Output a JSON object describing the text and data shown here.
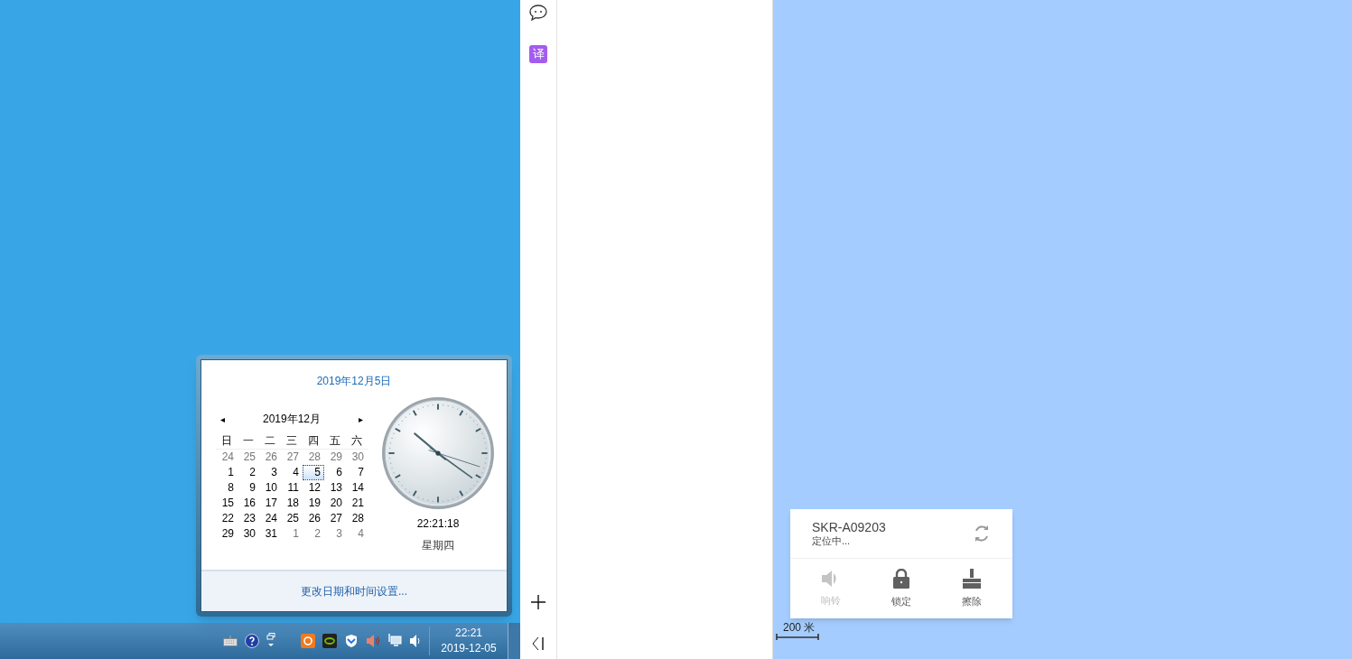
{
  "calendar_popup": {
    "title": "2019年12月5日",
    "month": "2019年12月",
    "prev": "◂",
    "next": "▸",
    "weekdays": [
      "日",
      "一",
      "二",
      "三",
      "四",
      "五",
      "六"
    ],
    "weeks": [
      [
        {
          "day": "24",
          "other_month": true,
          "selected": false
        },
        {
          "day": "25",
          "other_month": true,
          "selected": false
        },
        {
          "day": "26",
          "other_month": true,
          "selected": false
        },
        {
          "day": "27",
          "other_month": true,
          "selected": false
        },
        {
          "day": "28",
          "other_month": true,
          "selected": false
        },
        {
          "day": "29",
          "other_month": true,
          "selected": false
        },
        {
          "day": "30",
          "other_month": true,
          "selected": false
        }
      ],
      [
        {
          "day": "1",
          "other_month": false,
          "selected": false
        },
        {
          "day": "2",
          "other_month": false,
          "selected": false
        },
        {
          "day": "3",
          "other_month": false,
          "selected": false
        },
        {
          "day": "4",
          "other_month": false,
          "selected": false
        },
        {
          "day": "5",
          "other_month": false,
          "selected": true
        },
        {
          "day": "6",
          "other_month": false,
          "selected": false
        },
        {
          "day": "7",
          "other_month": false,
          "selected": false
        }
      ],
      [
        {
          "day": "8",
          "other_month": false,
          "selected": false
        },
        {
          "day": "9",
          "other_month": false,
          "selected": false
        },
        {
          "day": "10",
          "other_month": false,
          "selected": false
        },
        {
          "day": "11",
          "other_month": false,
          "selected": false
        },
        {
          "day": "12",
          "other_month": false,
          "selected": false
        },
        {
          "day": "13",
          "other_month": false,
          "selected": false
        },
        {
          "day": "14",
          "other_month": false,
          "selected": false
        }
      ],
      [
        {
          "day": "15",
          "other_month": false,
          "selected": false
        },
        {
          "day": "16",
          "other_month": false,
          "selected": false
        },
        {
          "day": "17",
          "other_month": false,
          "selected": false
        },
        {
          "day": "18",
          "other_month": false,
          "selected": false
        },
        {
          "day": "19",
          "other_month": false,
          "selected": false
        },
        {
          "day": "20",
          "other_month": false,
          "selected": false
        },
        {
          "day": "21",
          "other_month": false,
          "selected": false
        }
      ],
      [
        {
          "day": "22",
          "other_month": false,
          "selected": false
        },
        {
          "day": "23",
          "other_month": false,
          "selected": false
        },
        {
          "day": "24",
          "other_month": false,
          "selected": false
        },
        {
          "day": "25",
          "other_month": false,
          "selected": false
        },
        {
          "day": "26",
          "other_month": false,
          "selected": false
        },
        {
          "day": "27",
          "other_month": false,
          "selected": false
        },
        {
          "day": "28",
          "other_month": false,
          "selected": false
        }
      ],
      [
        {
          "day": "29",
          "other_month": false,
          "selected": false
        },
        {
          "day": "30",
          "other_month": false,
          "selected": false
        },
        {
          "day": "31",
          "other_month": false,
          "selected": false
        },
        {
          "day": "1",
          "other_month": true,
          "selected": false
        },
        {
          "day": "2",
          "other_month": true,
          "selected": false
        },
        {
          "day": "3",
          "other_month": true,
          "selected": false
        },
        {
          "day": "4",
          "other_month": true,
          "selected": false
        }
      ]
    ],
    "time": "22:21:18",
    "weekday": "星期四",
    "settings_link": "更改日期和时间设置..."
  },
  "taskbar": {
    "clock_time": "22:21",
    "clock_date": "2019-12-05"
  },
  "device_card": {
    "name": "SKR-A09203",
    "status": "定位中...",
    "actions": [
      {
        "kind": "ring",
        "label": "响铃",
        "disabled": true
      },
      {
        "kind": "lock",
        "label": "锁定",
        "disabled": false
      },
      {
        "kind": "erase",
        "label": "擦除",
        "disabled": false
      }
    ]
  },
  "sidebar": {
    "translate_label": "译"
  },
  "map": {
    "scale": "200 米"
  }
}
